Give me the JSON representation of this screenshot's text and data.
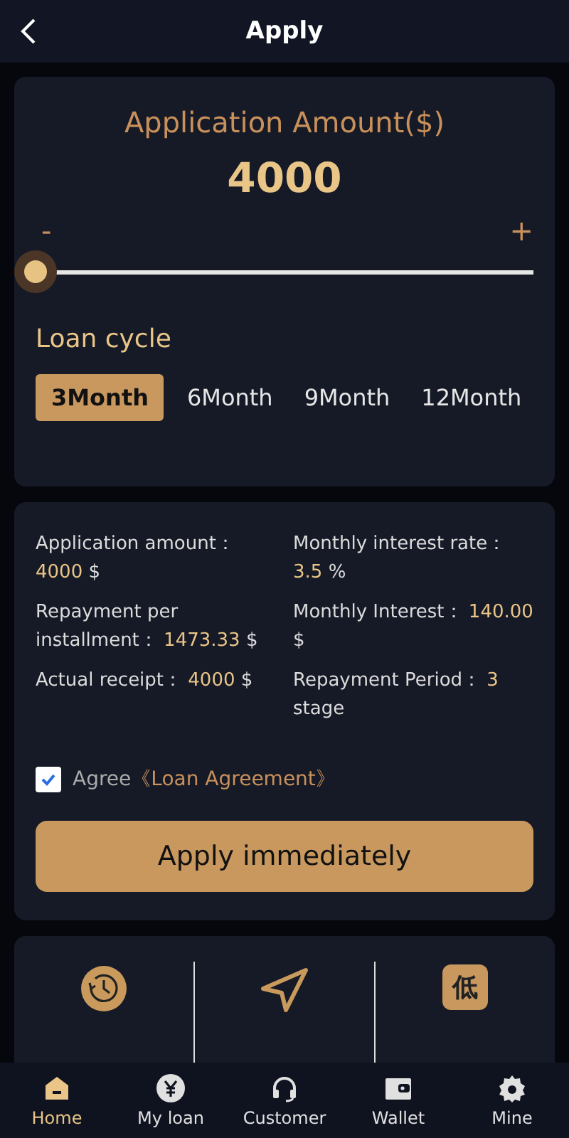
{
  "header": {
    "title": "Apply"
  },
  "amount": {
    "title": "Application Amount($)",
    "value": "4000",
    "minus": "-",
    "plus": "+"
  },
  "loan_cycle": {
    "title": "Loan cycle",
    "options": [
      {
        "label": "3Month",
        "selected": true
      },
      {
        "label": "6Month",
        "selected": false
      },
      {
        "label": "9Month",
        "selected": false
      },
      {
        "label": "12Month",
        "selected": false
      }
    ]
  },
  "details": [
    {
      "label": "Application amount：",
      "value": "4000",
      "unit": "$"
    },
    {
      "label": "Monthly interest rate：",
      "value": "3.5",
      "unit": "%"
    },
    {
      "label": "Repayment per installment：",
      "value": "1473.33",
      "unit": "$"
    },
    {
      "label": "Monthly Interest：",
      "value": "140.00",
      "unit": "$"
    },
    {
      "label": "Actual receipt：",
      "value": "4000",
      "unit": "$"
    },
    {
      "label": "Repayment Period：",
      "value": "3",
      "unit": "stage"
    }
  ],
  "agreement": {
    "checked": true,
    "text": "Agree",
    "link": "《Loan Agreement》"
  },
  "apply_button": "Apply immediately",
  "features": [
    {
      "kind": "clock"
    },
    {
      "kind": "send"
    },
    {
      "kind": "badge",
      "glyph": "低"
    }
  ],
  "tab_bar": [
    {
      "label": "Home",
      "selected": true
    },
    {
      "label": "My loan",
      "selected": false
    },
    {
      "label": "Customer",
      "selected": false
    },
    {
      "label": "Wallet",
      "selected": false
    },
    {
      "label": "Mine",
      "selected": false
    }
  ]
}
